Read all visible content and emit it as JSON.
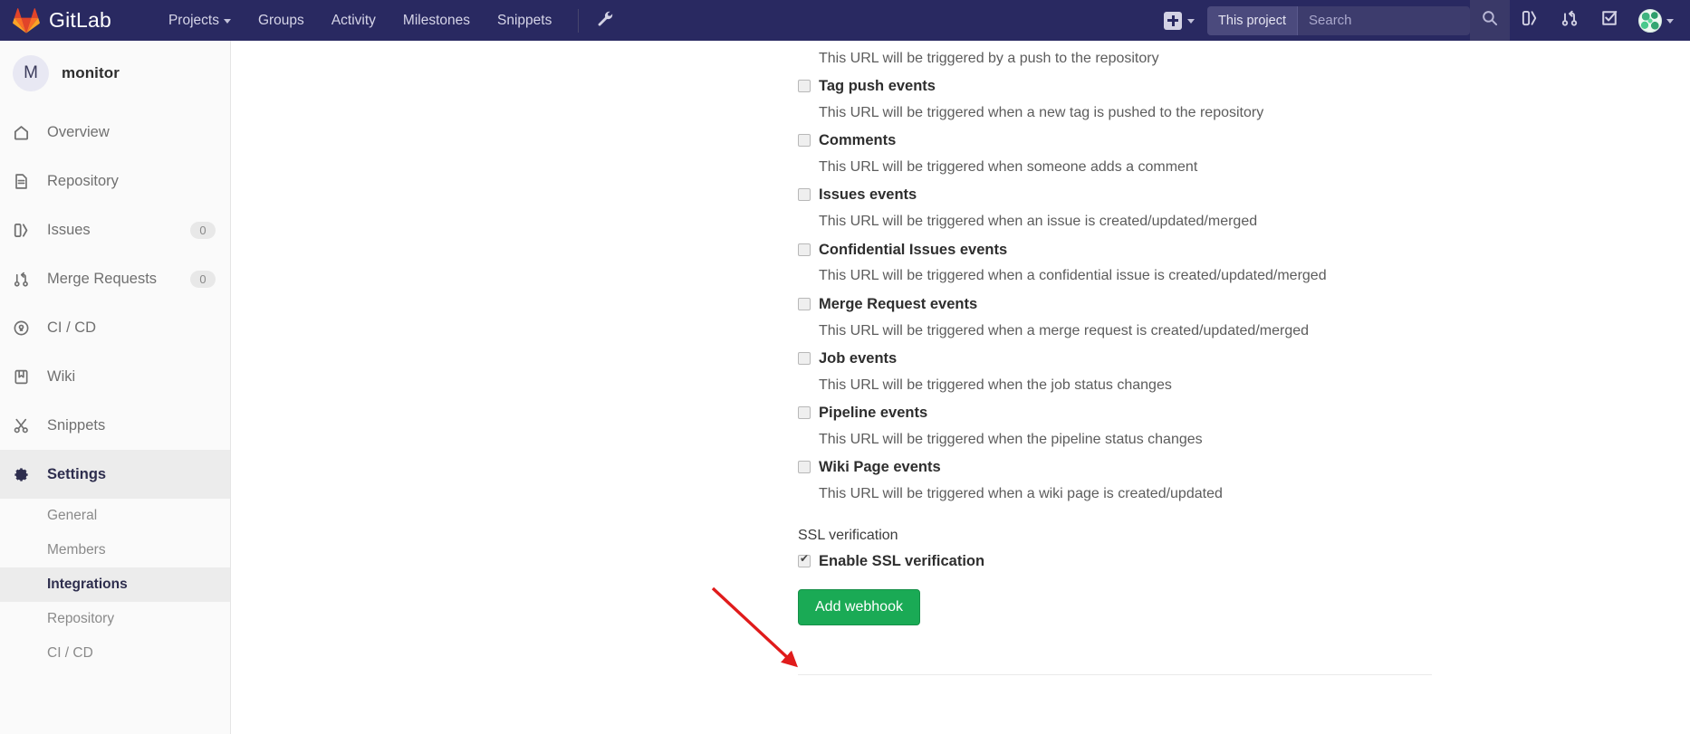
{
  "navbar": {
    "brand": "GitLab",
    "logo_icon": "gitlab-logo-icon",
    "links": [
      {
        "label": "Projects",
        "icon": "chevron-down-icon",
        "has_caret": true
      },
      {
        "label": "Groups",
        "has_caret": false
      },
      {
        "label": "Activity",
        "has_caret": false
      },
      {
        "label": "Milestones",
        "has_caret": false
      },
      {
        "label": "Snippets",
        "has_caret": false
      }
    ],
    "wrench_icon": "wrench-icon",
    "new_icon": "plus-icon",
    "new_caret_icon": "chevron-down-icon",
    "search": {
      "scope_label": "This project",
      "placeholder": "Search",
      "value": "",
      "icon": "search-icon"
    },
    "right_icons": [
      {
        "name": "issues-icon"
      },
      {
        "name": "merge-requests-icon"
      },
      {
        "name": "todos-icon"
      }
    ],
    "avatar_icon": "user-avatar",
    "avatar_caret_icon": "chevron-down-icon",
    "background_color": "#292961"
  },
  "sidebar": {
    "project": {
      "initial": "M",
      "name": "monitor"
    },
    "items": [
      {
        "label": "Overview",
        "icon": "home-icon",
        "badge": null
      },
      {
        "label": "Repository",
        "icon": "doc-icon",
        "badge": null
      },
      {
        "label": "Issues",
        "icon": "issues-icon",
        "badge": "0"
      },
      {
        "label": "Merge Requests",
        "icon": "merge-requests-icon",
        "badge": "0"
      },
      {
        "label": "CI / CD",
        "icon": "rocket-icon",
        "badge": null
      },
      {
        "label": "Wiki",
        "icon": "book-icon",
        "badge": null
      },
      {
        "label": "Snippets",
        "icon": "scissors-icon",
        "badge": null
      },
      {
        "label": "Settings",
        "icon": "gear-icon",
        "badge": null,
        "active_parent": true
      }
    ],
    "sub_items": [
      {
        "label": "General",
        "active": false
      },
      {
        "label": "Members",
        "active": false
      },
      {
        "label": "Integrations",
        "active": true
      },
      {
        "label": "Repository",
        "active": false
      },
      {
        "label": "CI / CD",
        "active": false
      }
    ]
  },
  "main": {
    "top_orphan_desc": "This URL will be triggered by a push to the repository",
    "events": [
      {
        "title": "Tag push events",
        "desc": "This URL will be triggered when a new tag is pushed to the repository",
        "checked": false
      },
      {
        "title": "Comments",
        "desc": "This URL will be triggered when someone adds a comment",
        "checked": false
      },
      {
        "title": "Issues events",
        "desc": "This URL will be triggered when an issue is created/updated/merged",
        "checked": false
      },
      {
        "title": "Confidential Issues events",
        "desc": "This URL will be triggered when a confidential issue is created/updated/merged",
        "checked": false
      },
      {
        "title": "Merge Request events",
        "desc": "This URL will be triggered when a merge request is created/updated/merged",
        "checked": false
      },
      {
        "title": "Job events",
        "desc": "This URL will be triggered when the job status changes",
        "checked": false
      },
      {
        "title": "Pipeline events",
        "desc": "This URL will be triggered when the pipeline status changes",
        "checked": false
      },
      {
        "title": "Wiki Page events",
        "desc": "This URL will be triggered when a wiki page is created/updated",
        "checked": false
      }
    ],
    "ssl": {
      "section_label": "SSL verification",
      "checkbox_label": "Enable SSL verification",
      "checked": true
    },
    "submit_button": "Add webhook",
    "submit_button_color": "#1aaa55"
  },
  "annotation": {
    "type": "arrow",
    "color": "#e01b1b",
    "target": "add-webhook-button"
  }
}
